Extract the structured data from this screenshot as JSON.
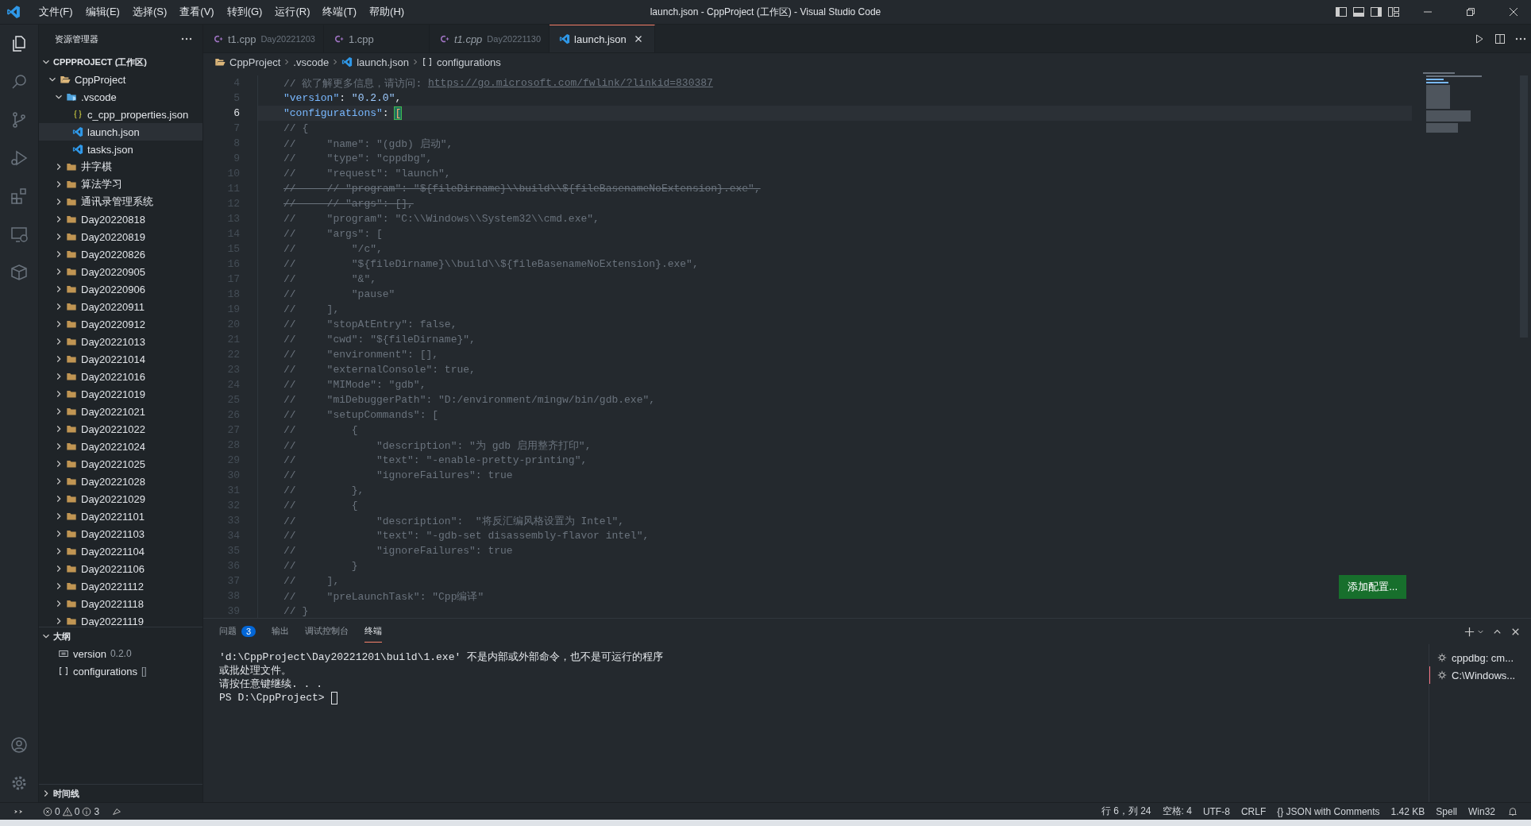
{
  "title_bar": {
    "menu": [
      "文件(F)",
      "编辑(E)",
      "选择(S)",
      "查看(V)",
      "转到(G)",
      "运行(R)",
      "终端(T)",
      "帮助(H)"
    ],
    "title": "launch.json - CppProject (工作区) - Visual Studio Code"
  },
  "explorer": {
    "title": "资源管理器",
    "workspace": {
      "label": "CPPPROJECT (工作区)",
      "expanded": true
    },
    "tree": [
      {
        "label": "CppProject",
        "kind": "project",
        "expanded": true,
        "selected": false,
        "children": [
          {
            "label": ".vscode",
            "kind": "vscode-folder",
            "expanded": true,
            "selected": false,
            "children": [
              {
                "label": "c_cpp_properties.json",
                "kind": "json-file",
                "selected": false
              },
              {
                "label": "launch.json",
                "kind": "vscode-file",
                "selected": true
              },
              {
                "label": "tasks.json",
                "kind": "vscode-file",
                "selected": false
              }
            ]
          },
          {
            "label": "井字棋",
            "kind": "folder",
            "expanded": false,
            "selected": false
          },
          {
            "label": "算法学习",
            "kind": "folder",
            "expanded": false,
            "selected": false
          },
          {
            "label": "通讯录管理系统",
            "kind": "folder",
            "expanded": false,
            "selected": false
          },
          {
            "label": "Day20220818",
            "kind": "folder",
            "expanded": false,
            "selected": false
          },
          {
            "label": "Day20220819",
            "kind": "folder",
            "expanded": false,
            "selected": false
          },
          {
            "label": "Day20220826",
            "kind": "folder",
            "expanded": false,
            "selected": false
          },
          {
            "label": "Day20220905",
            "kind": "folder",
            "expanded": false,
            "selected": false
          },
          {
            "label": "Day20220906",
            "kind": "folder",
            "expanded": false,
            "selected": false
          },
          {
            "label": "Day20220911",
            "kind": "folder",
            "expanded": false,
            "selected": false
          },
          {
            "label": "Day20220912",
            "kind": "folder",
            "expanded": false,
            "selected": false
          },
          {
            "label": "Day20221013",
            "kind": "folder",
            "expanded": false,
            "selected": false
          },
          {
            "label": "Day20221014",
            "kind": "folder",
            "expanded": false,
            "selected": false
          },
          {
            "label": "Day20221016",
            "kind": "folder",
            "expanded": false,
            "selected": false
          },
          {
            "label": "Day20221019",
            "kind": "folder",
            "expanded": false,
            "selected": false
          },
          {
            "label": "Day20221021",
            "kind": "folder",
            "expanded": false,
            "selected": false
          },
          {
            "label": "Day20221022",
            "kind": "folder",
            "expanded": false,
            "selected": false
          },
          {
            "label": "Day20221024",
            "kind": "folder",
            "expanded": false,
            "selected": false
          },
          {
            "label": "Day20221025",
            "kind": "folder",
            "expanded": false,
            "selected": false
          },
          {
            "label": "Day20221028",
            "kind": "folder",
            "expanded": false,
            "selected": false
          },
          {
            "label": "Day20221029",
            "kind": "folder",
            "expanded": false,
            "selected": false
          },
          {
            "label": "Day20221101",
            "kind": "folder",
            "expanded": false,
            "selected": false
          },
          {
            "label": "Day20221103",
            "kind": "folder",
            "expanded": false,
            "selected": false
          },
          {
            "label": "Day20221104",
            "kind": "folder",
            "expanded": false,
            "selected": false
          },
          {
            "label": "Day20221106",
            "kind": "folder",
            "expanded": false,
            "selected": false
          },
          {
            "label": "Day20221112",
            "kind": "folder",
            "expanded": false,
            "selected": false
          },
          {
            "label": "Day20221118",
            "kind": "folder",
            "expanded": false,
            "selected": false
          },
          {
            "label": "Day20221119",
            "kind": "folder",
            "expanded": false,
            "selected": false
          }
        ]
      }
    ]
  },
  "outline": {
    "title": "大纲",
    "expanded": true,
    "items": [
      {
        "kind": "object",
        "label": "version",
        "detail": "0.2.0"
      },
      {
        "kind": "array",
        "label": "configurations",
        "detail": "[]"
      }
    ]
  },
  "timeline": {
    "title": "时间线",
    "expanded": false
  },
  "tabs": [
    {
      "label": "t1.cpp",
      "detail": "Day20221203",
      "kind": "cpp",
      "preview": false,
      "selected": false
    },
    {
      "label": "1.cpp",
      "kind": "cpp",
      "preview": false,
      "selected": false
    },
    {
      "label": "t1.cpp",
      "detail": "Day20221130",
      "kind": "cpp",
      "preview": true,
      "selected": false
    },
    {
      "label": "launch.json",
      "kind": "vscode",
      "preview": false,
      "selected": true
    }
  ],
  "breadcrumb": [
    {
      "label": "CppProject",
      "kind": "project"
    },
    {
      "label": ".vscode",
      "kind": "folder"
    },
    {
      "label": "launch.json",
      "kind": "vscode"
    },
    {
      "label": "configurations",
      "kind": "array"
    }
  ],
  "code_lines": [
    {
      "number": "4",
      "kind": "comment-link",
      "text": "// 欲了解更多信息，请访问: ",
      "link": "https://go.microsoft.com/fwlink/?linkid=830387",
      "current": false
    },
    {
      "number": "5",
      "kind": "code",
      "current": false,
      "segments": [
        {
          "kind": "key",
          "s": "\"version\""
        },
        {
          "kind": "punct",
          "s": ": "
        },
        {
          "kind": "string",
          "s": "\"0.2.0\""
        },
        {
          "kind": "punct",
          "s": ","
        }
      ]
    },
    {
      "number": "6",
      "kind": "code",
      "current": true,
      "segments": [
        {
          "kind": "key",
          "s": "\"configurations\""
        },
        {
          "kind": "punct",
          "s": ": "
        },
        {
          "kind": "bracket",
          "s": "["
        }
      ]
    },
    {
      "number": "7",
      "kind": "comment",
      "current": false,
      "text": "// {"
    },
    {
      "number": "8",
      "kind": "comment",
      "current": false,
      "text": "//     \"name\": \"(gdb) 启动\","
    },
    {
      "number": "9",
      "kind": "comment",
      "current": false,
      "text": "//     \"type\": \"cppdbg\","
    },
    {
      "number": "10",
      "kind": "comment",
      "current": false,
      "text": "//     \"request\": \"launch\","
    },
    {
      "number": "11",
      "kind": "strike",
      "current": false,
      "text": "//     // \"program\": \"${fileDirname}\\\\build\\\\${fileBasenameNoExtension}.exe\","
    },
    {
      "number": "12",
      "kind": "strike",
      "current": false,
      "text": "//     // \"args\": [],"
    },
    {
      "number": "13",
      "kind": "comment",
      "current": false,
      "text": "//     \"program\": \"C:\\\\Windows\\\\System32\\\\cmd.exe\","
    },
    {
      "number": "14",
      "kind": "comment",
      "current": false,
      "text": "//     \"args\": ["
    },
    {
      "number": "15",
      "kind": "comment",
      "current": false,
      "text": "//         \"/c\","
    },
    {
      "number": "16",
      "kind": "comment",
      "current": false,
      "text": "//         \"${fileDirname}\\\\build\\\\${fileBasenameNoExtension}.exe\","
    },
    {
      "number": "17",
      "kind": "comment",
      "current": false,
      "text": "//         \"&\","
    },
    {
      "number": "18",
      "kind": "comment",
      "current": false,
      "text": "//         \"pause\""
    },
    {
      "number": "19",
      "kind": "comment",
      "current": false,
      "text": "//     ],"
    },
    {
      "number": "20",
      "kind": "comment",
      "current": false,
      "text": "//     \"stopAtEntry\": false,"
    },
    {
      "number": "21",
      "kind": "comment",
      "current": false,
      "text": "//     \"cwd\": \"${fileDirname}\","
    },
    {
      "number": "22",
      "kind": "comment",
      "current": false,
      "text": "//     \"environment\": [],"
    },
    {
      "number": "23",
      "kind": "comment",
      "current": false,
      "text": "//     \"externalConsole\": true,"
    },
    {
      "number": "24",
      "kind": "comment",
      "current": false,
      "text": "//     \"MIMode\": \"gdb\","
    },
    {
      "number": "25",
      "kind": "comment",
      "current": false,
      "text": "//     \"miDebuggerPath\": \"D:/environment/mingw/bin/gdb.exe\","
    },
    {
      "number": "26",
      "kind": "comment",
      "current": false,
      "text": "//     \"setupCommands\": ["
    },
    {
      "number": "27",
      "kind": "comment",
      "current": false,
      "text": "//         {"
    },
    {
      "number": "28",
      "kind": "comment",
      "current": false,
      "text": "//             \"description\": \"为 gdb 启用整齐打印\","
    },
    {
      "number": "29",
      "kind": "comment",
      "current": false,
      "text": "//             \"text\": \"-enable-pretty-printing\","
    },
    {
      "number": "30",
      "kind": "comment",
      "current": false,
      "text": "//             \"ignoreFailures\": true"
    },
    {
      "number": "31",
      "kind": "comment",
      "current": false,
      "text": "//         },"
    },
    {
      "number": "32",
      "kind": "comment",
      "current": false,
      "text": "//         {"
    },
    {
      "number": "33",
      "kind": "comment",
      "current": false,
      "text": "//             \"description\":  \"将反汇编风格设置为 Intel\","
    },
    {
      "number": "34",
      "kind": "comment",
      "current": false,
      "text": "//             \"text\": \"-gdb-set disassembly-flavor intel\","
    },
    {
      "number": "35",
      "kind": "comment",
      "current": false,
      "text": "//             \"ignoreFailures\": true"
    },
    {
      "number": "36",
      "kind": "comment",
      "current": false,
      "text": "//         }"
    },
    {
      "number": "37",
      "kind": "comment",
      "current": false,
      "text": "//     ],"
    },
    {
      "number": "38",
      "kind": "comment",
      "current": false,
      "text": "//     \"preLaunchTask\": \"Cpp编译\""
    },
    {
      "number": "39",
      "kind": "comment",
      "current": false,
      "text": "// }"
    }
  ],
  "add_config_button": "添加配置...",
  "panel": {
    "tabs": [
      {
        "label": "问题",
        "badge": "3",
        "selected": false
      },
      {
        "label": "输出",
        "selected": false
      },
      {
        "label": "调试控制台",
        "selected": false
      },
      {
        "label": "终端",
        "selected": true
      }
    ],
    "terminal_lines": [
      "'d:\\CppProject\\Day20221201\\build\\1.exe' 不是内部或外部命令，也不是可运行的程序",
      "或批处理文件。",
      "请按任意键继续. . ."
    ],
    "prompt": "PS D:\\CppProject>",
    "terminals": [
      {
        "label": "cppdbg: cm...",
        "selected": false
      },
      {
        "label": "C:\\Windows...",
        "selected": true
      }
    ]
  },
  "status_bar": {
    "errors": "0",
    "warnings": "0",
    "info": "3",
    "right": [
      "行 6，列 24",
      "空格: 4",
      "UTF-8",
      "CRLF",
      "{} JSON with Comments",
      "1.42 KB",
      "Spell",
      "Win32"
    ]
  }
}
